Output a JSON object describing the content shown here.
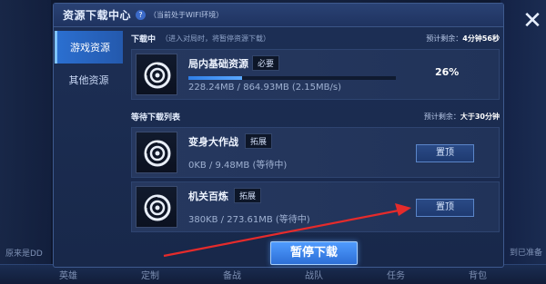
{
  "background": {
    "left_text": "原来是DD",
    "right_text": "到已准备",
    "nav": [
      "英雄",
      "定制",
      "备战",
      "战队",
      "任务",
      "背包"
    ]
  },
  "dialog": {
    "title": "资源下载中心",
    "help_icon": "?",
    "title_note": "（当前处于WIFI环境）",
    "close_icon": "✕"
  },
  "sidebar": {
    "items": [
      {
        "label": "游戏资源",
        "active": true
      },
      {
        "label": "其他资源",
        "active": false
      }
    ]
  },
  "downloading": {
    "title": "下载中",
    "note": "（进入对局时，将暂停资源下载）",
    "remaining_label": "预计剩余：",
    "remaining_value": "4分钟56秒",
    "item": {
      "name": "局内基础资源",
      "tag": "必要",
      "progress": 0.26,
      "percent": "26%",
      "size": "228.24MB / 864.93MB (2.15MB/s)"
    }
  },
  "queue": {
    "title": "等待下载列表",
    "remaining_label": "预计剩余：",
    "remaining_value": "大于30分钟",
    "items": [
      {
        "name": "变身大作战",
        "tag": "拓展",
        "size": "0KB / 9.48MB (等待中)",
        "button": "置顶"
      },
      {
        "name": "机关百炼",
        "tag": "拓展",
        "size": "380KB / 273.61MB (等待中)",
        "button": "置顶"
      }
    ]
  },
  "pause_button": "暂停下载",
  "colors": {
    "accent": "#2d6fd6",
    "annotation_arrow": "#e52b2b"
  },
  "icons": [
    "help-icon",
    "close-icon",
    "resource-disc-icon"
  ]
}
